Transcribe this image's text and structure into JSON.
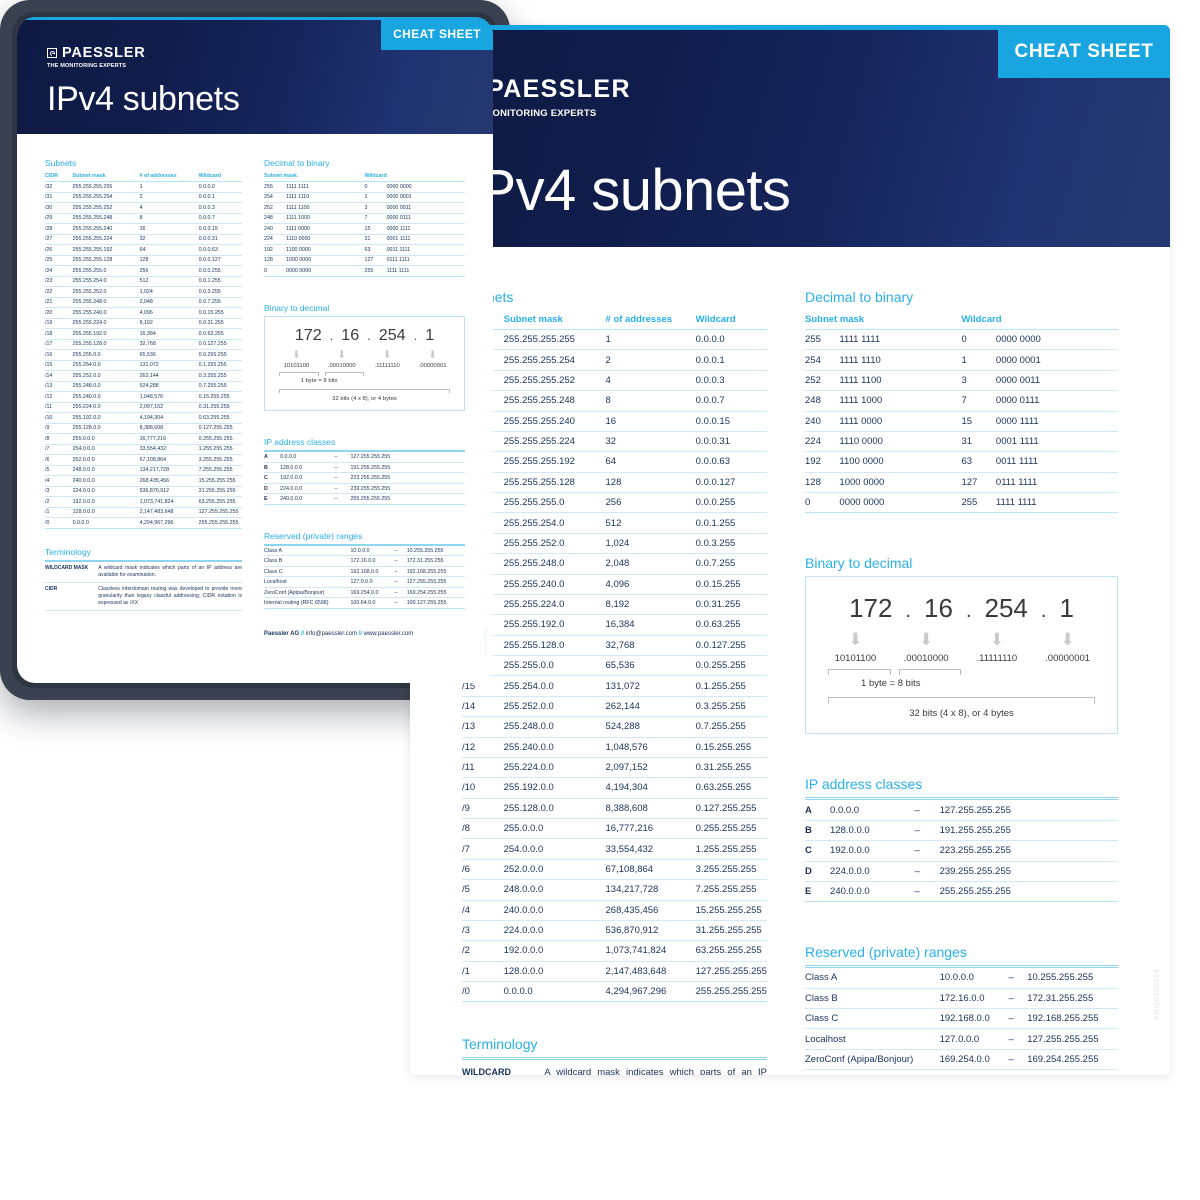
{
  "brand": {
    "name": "PAESSLER",
    "tagline": "THE MONITORING EXPERTS",
    "badge": "CHEAT SHEET",
    "accent": "#18a5e0",
    "header_dark": "#0e1a42",
    "text_navy": "#17325c"
  },
  "title": "IPv4 subnets",
  "sections": {
    "subnets": "Subnets",
    "decimal_to_binary": "Decimal to binary",
    "binary_to_decimal": "Binary to decimal",
    "ip_address_classes": "IP address classes",
    "reserved_ranges": "Reserved (private) ranges",
    "terminology": "Terminology"
  },
  "subnets_table": {
    "headers": [
      "CIDR",
      "Subnet mask",
      "# of addresses",
      "Wildcard"
    ],
    "rows": [
      [
        "/32",
        "255.255.255.255",
        "1",
        "0.0.0.0"
      ],
      [
        "/31",
        "255.255.255.254",
        "2",
        "0.0.0.1"
      ],
      [
        "/30",
        "255.255.255.252",
        "4",
        "0.0.0.3"
      ],
      [
        "/29",
        "255.255.255.248",
        "8",
        "0.0.0.7"
      ],
      [
        "/28",
        "255.255.255.240",
        "16",
        "0.0.0.15"
      ],
      [
        "/27",
        "255.255.255.224",
        "32",
        "0.0.0.31"
      ],
      [
        "/26",
        "255.255.255.192",
        "64",
        "0.0.0.63"
      ],
      [
        "/25",
        "255.255.255.128",
        "128",
        "0.0.0.127"
      ],
      [
        "/24",
        "255.255.255.0",
        "256",
        "0.0.0.255"
      ],
      [
        "/23",
        "255.255.254.0",
        "512",
        "0.0.1.255"
      ],
      [
        "/22",
        "255.255.252.0",
        "1,024",
        "0.0.3.255"
      ],
      [
        "/21",
        "255.255.248.0",
        "2,048",
        "0.0.7.255"
      ],
      [
        "/20",
        "255.255.240.0",
        "4,096",
        "0.0.15.255"
      ],
      [
        "/19",
        "255.255.224.0",
        "8,192",
        "0.0.31.255"
      ],
      [
        "/18",
        "255.255.192.0",
        "16,384",
        "0.0.63.255"
      ],
      [
        "/17",
        "255.255.128.0",
        "32,768",
        "0.0.127.255"
      ],
      [
        "/16",
        "255.255.0.0",
        "65,536",
        "0.0.255.255"
      ],
      [
        "/15",
        "255.254.0.0",
        "131,072",
        "0.1.255.255"
      ],
      [
        "/14",
        "255.252.0.0",
        "262,144",
        "0.3.255.255"
      ],
      [
        "/13",
        "255.248.0.0",
        "524,288",
        "0.7.255.255"
      ],
      [
        "/12",
        "255.240.0.0",
        "1,048,576",
        "0.15.255.255"
      ],
      [
        "/11",
        "255.224.0.0",
        "2,097,152",
        "0.31.255.255"
      ],
      [
        "/10",
        "255.192.0.0",
        "4,194,304",
        "0.63.255.255"
      ],
      [
        "/9",
        "255.128.0.0",
        "8,388,608",
        "0.127.255.255"
      ],
      [
        "/8",
        "255.0.0.0",
        "16,777,216",
        "0.255.255.255"
      ],
      [
        "/7",
        "254.0.0.0",
        "33,554,432",
        "1.255.255.255"
      ],
      [
        "/6",
        "252.0.0.0",
        "67,108,864",
        "3.255.255.255"
      ],
      [
        "/5",
        "248.0.0.0",
        "134,217,728",
        "7.255.255.255"
      ],
      [
        "/4",
        "240.0.0.0",
        "268,435,456",
        "15.255.255.255"
      ],
      [
        "/3",
        "224.0.0.0",
        "536,870,912",
        "31.255.255.255"
      ],
      [
        "/2",
        "192.0.0.0",
        "1,073,741,824",
        "63.255.255.255"
      ],
      [
        "/1",
        "128.0.0.0",
        "2,147,483,648",
        "127.255.255.255"
      ],
      [
        "/0",
        "0.0.0.0",
        "4,294,967,296",
        "255.255.255.255"
      ]
    ]
  },
  "decimal_to_binary_table": {
    "headers": [
      "Subnet mask",
      "Wildcard"
    ],
    "rows": [
      [
        "255",
        "1111 1111",
        "0",
        "0000 0000"
      ],
      [
        "254",
        "1111 1110",
        "1",
        "0000 0001"
      ],
      [
        "252",
        "1111 1100",
        "3",
        "0000 0011"
      ],
      [
        "248",
        "1111 1000",
        "7",
        "0000 0111"
      ],
      [
        "240",
        "1111 0000",
        "15",
        "0000 1111"
      ],
      [
        "224",
        "1110 0000",
        "31",
        "0001 1111"
      ],
      [
        "192",
        "1100 0000",
        "63",
        "0011 1111"
      ],
      [
        "128",
        "1000 0000",
        "127",
        "0111 1111"
      ],
      [
        "0",
        "0000 0000",
        "255",
        "1111 1111"
      ]
    ]
  },
  "binary_to_decimal": {
    "octets": [
      "172",
      "16",
      "254",
      "1"
    ],
    "separators": [
      ".",
      ".",
      "."
    ],
    "binary": [
      "10101100",
      ".00010000",
      ".11111110",
      ".00000001"
    ],
    "byte_label": "1 byte  =  8 bits",
    "total_label": "32 bits (4 x 8), or 4 bytes"
  },
  "ip_address_classes": {
    "rows": [
      [
        "A",
        "0.0.0.0",
        "–",
        "127.255.255.255"
      ],
      [
        "B",
        "128.0.0.0",
        "–",
        "191.255.255.255"
      ],
      [
        "C",
        "192.0.0.0",
        "–",
        "223.255.255.255"
      ],
      [
        "D",
        "224.0.0.0",
        "–",
        "239.255.255.255"
      ],
      [
        "E",
        "240.0.0.0",
        "–",
        "255.255.255.255"
      ]
    ]
  },
  "reserved_ranges": {
    "rows": [
      [
        "Class A",
        "10.0.0.0",
        "–",
        "10.255.255.255"
      ],
      [
        "Class B",
        "172.16.0.0",
        "–",
        "172.31.255.255"
      ],
      [
        "Class C",
        "192.168.0.0",
        "–",
        "192.168.255.255"
      ],
      [
        "Localhost",
        "127.0.0.0",
        "–",
        "127.255.255.255"
      ],
      [
        "ZeroConf (Apipa/Bonjour)",
        "169.254.0.0",
        "–",
        "169.254.255.255"
      ],
      [
        "Internal routing (RFC 6598)",
        "100.64.0.0",
        "–",
        "100.127.255.255"
      ]
    ]
  },
  "terminology": {
    "rows": [
      {
        "term": "WILDCARD MASK",
        "definition": "A wildcard mask indicates which parts of an IP address are available for examination."
      },
      {
        "term": "CIDR",
        "definition": "Classless interdomain routing was developed to provide more granularity than legacy classful addressing; CIDR notation is expressed as /XX"
      }
    ]
  },
  "footer": {
    "company": "Paessler AG",
    "sep": "//",
    "email": "info@paessler.com",
    "website": "www.paessler.com",
    "version_code": "EN/20220214"
  }
}
